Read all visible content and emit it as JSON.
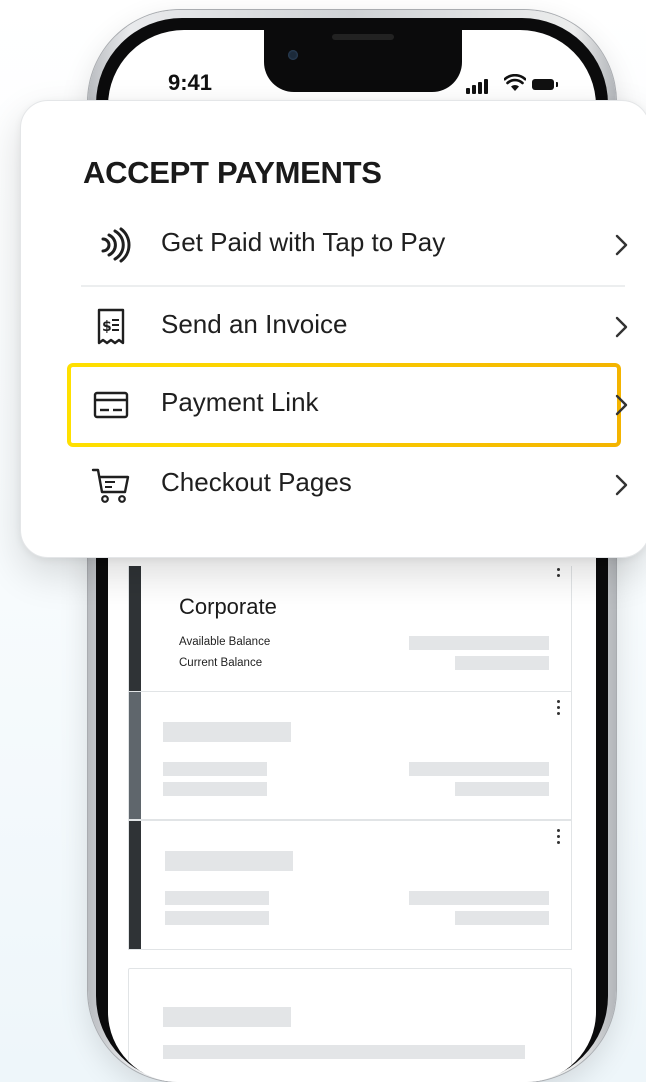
{
  "status_bar": {
    "time": "9:41"
  },
  "menu": {
    "heading": "ACCEPT PAYMENTS",
    "items": [
      {
        "label": "Get Paid with Tap to Pay",
        "icon": "contactless-icon"
      },
      {
        "label": "Send an Invoice",
        "icon": "invoice-icon"
      },
      {
        "label": "Payment Link",
        "icon": "card-icon",
        "highlighted": true
      },
      {
        "label": "Checkout Pages",
        "icon": "cart-icon"
      }
    ],
    "highlight_color": "#f4b400"
  },
  "accounts": {
    "corporate": {
      "title": "Corporate",
      "available_label": "Available Balance",
      "current_label": "Current Balance"
    }
  },
  "colors": {
    "card_edge_dark": "#2f3336",
    "card_edge_mid": "#5f666c"
  }
}
